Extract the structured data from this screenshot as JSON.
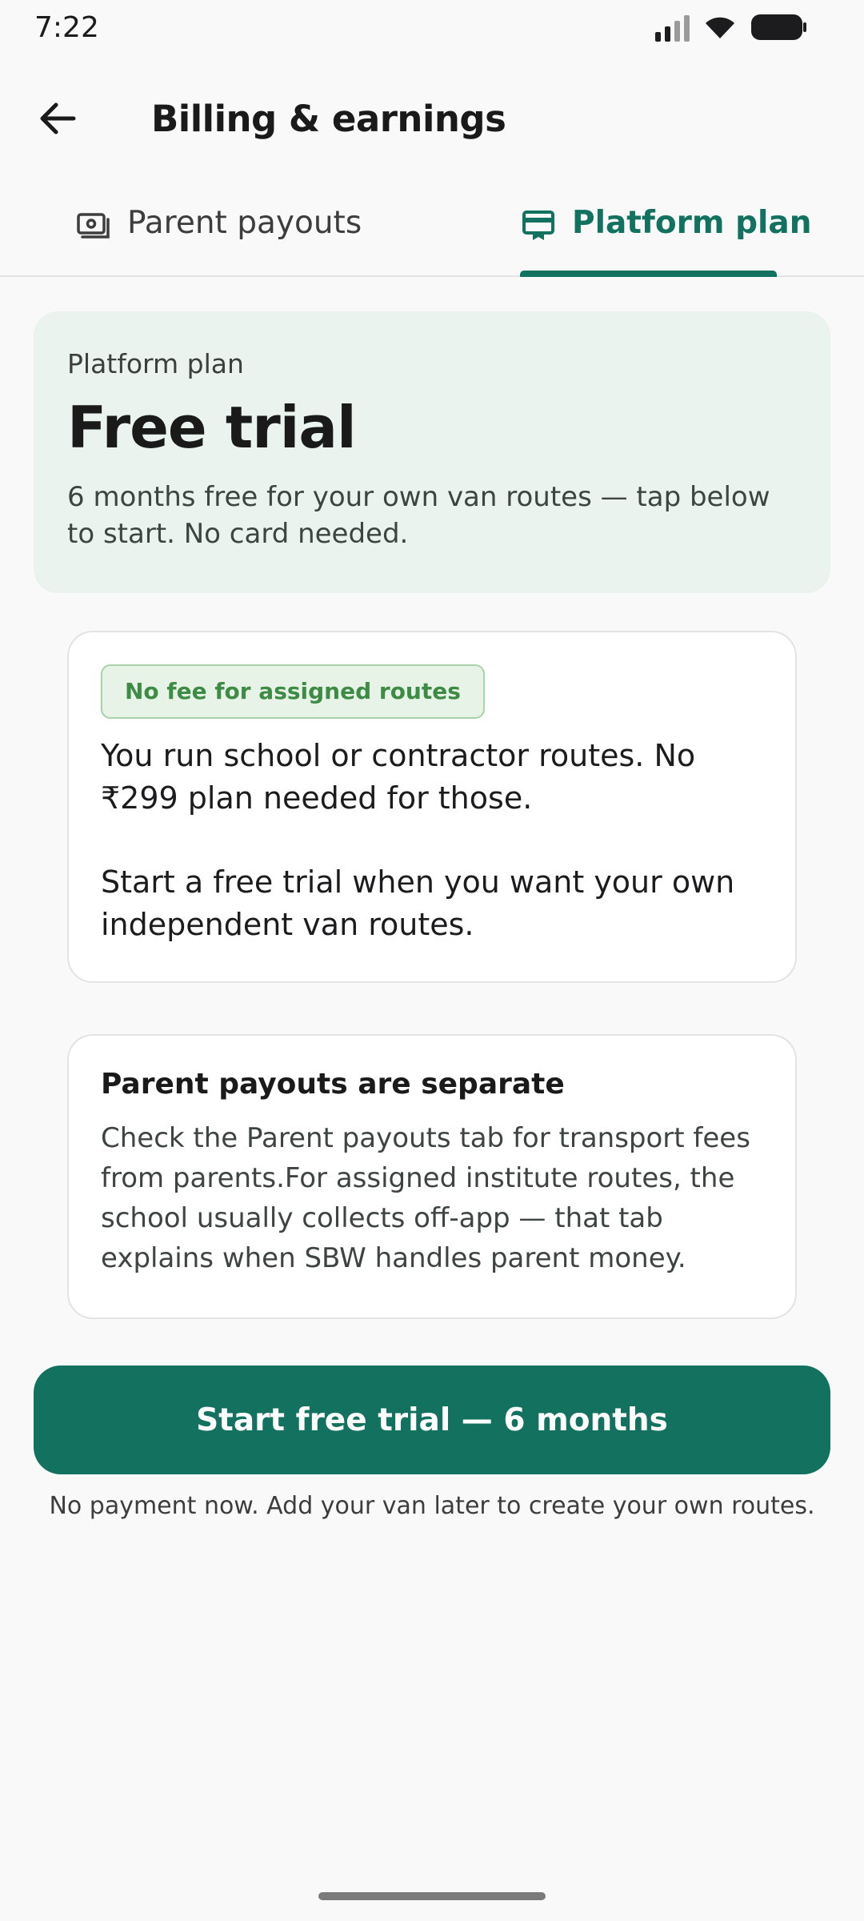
{
  "status_bar": {
    "time": "7:22",
    "icons": [
      "signal-icon",
      "wifi-icon",
      "battery-icon"
    ]
  },
  "app_bar": {
    "back_icon": "arrow-back-icon",
    "title": "Billing & earnings"
  },
  "tabs": [
    {
      "label": "Parent payouts",
      "icon": "cash-icon",
      "selected": false
    },
    {
      "label": "Platform plan",
      "icon": "card-icon",
      "selected": true
    }
  ],
  "plan": {
    "kicker": "Platform plan",
    "title": "Free trial",
    "description": "6 months free for your own van routes — tap below to start. No card needed."
  },
  "assigned_card": {
    "badge": "No fee for assigned routes",
    "text_1": "You run school or contractor routes. No ₹299 plan needed for those.",
    "text_2": "Start a free trial when you want your own independent van routes."
  },
  "separate_card": {
    "title": "Parent payouts are separate",
    "body": "Check the Parent payouts tab for transport fees from parents.For assigned institute routes, the school usually collects off-app — that tab explains when SBW handles parent money."
  },
  "cta": {
    "label": "Start free trial — 6 months",
    "note": "No payment now. Add your van later to create your own routes."
  },
  "colors": {
    "accent": "#13715f",
    "plan_card_bg": "#ebf3ef",
    "badge_text": "#3d8b45",
    "badge_bg": "#e8f3e8",
    "background": "#f9f9f9"
  }
}
